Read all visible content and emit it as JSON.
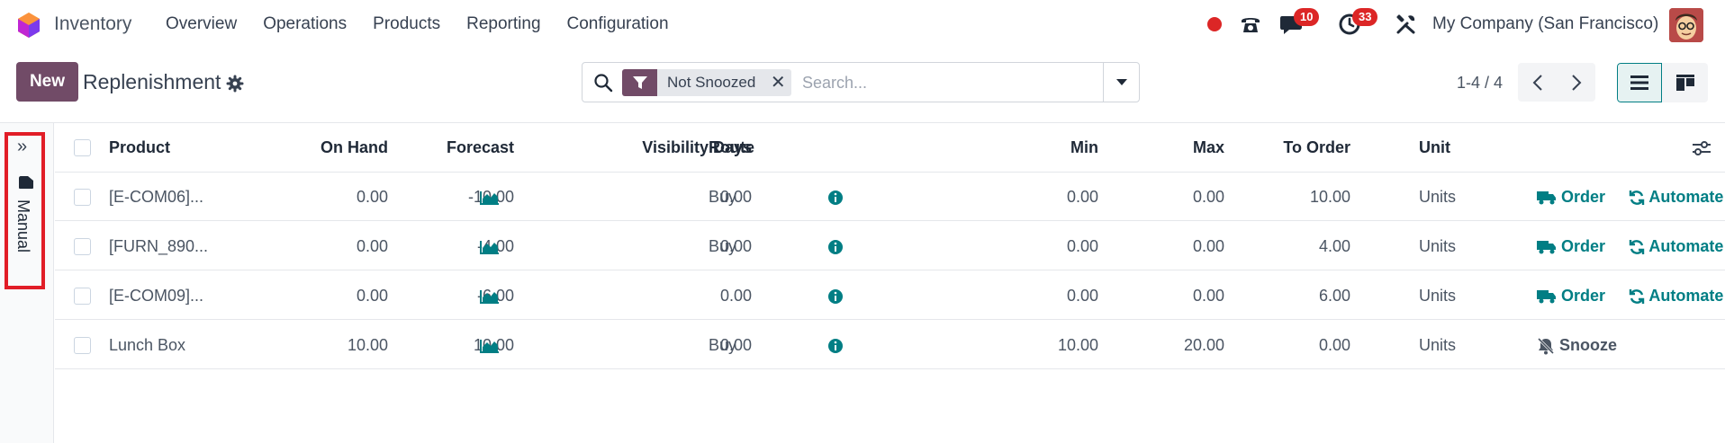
{
  "navbar": {
    "app_name": "Inventory",
    "menu": [
      "Overview",
      "Operations",
      "Products",
      "Reporting",
      "Configuration"
    ],
    "chat_badge": "10",
    "activity_badge": "33",
    "company": "My Company (San Francisco)"
  },
  "control": {
    "new_label": "New",
    "title": "Replenishment",
    "facet_label": "Not Snoozed",
    "search_placeholder": "Search...",
    "pager": "1-4 / 4"
  },
  "side_panel": {
    "label": "Manual"
  },
  "table": {
    "columns": {
      "product": "Product",
      "on_hand": "On Hand",
      "forecast": "Forecast",
      "visibility_days": "Visibility Days",
      "route": "Route",
      "min": "Min",
      "max": "Max",
      "to_order": "To Order",
      "unit": "Unit"
    },
    "rows": [
      {
        "product": "[E-COM06]...",
        "on_hand": "0.00",
        "forecast": "-10.00",
        "visibility_days": "0.00",
        "route": "Buy",
        "min": "0.00",
        "max": "0.00",
        "to_order": "10.00",
        "unit": "Units",
        "action": "Order",
        "automate": "Automate"
      },
      {
        "product": "[FURN_890...",
        "on_hand": "0.00",
        "forecast": "-4.00",
        "visibility_days": "0.00",
        "route": "Buy",
        "min": "0.00",
        "max": "0.00",
        "to_order": "4.00",
        "unit": "Units",
        "action": "Order",
        "automate": "Automate"
      },
      {
        "product": "[E-COM09]...",
        "on_hand": "0.00",
        "forecast": "-6.00",
        "visibility_days": "0.00",
        "route": "",
        "min": "0.00",
        "max": "0.00",
        "to_order": "6.00",
        "unit": "Units",
        "action": "Order",
        "automate": "Automate"
      },
      {
        "product": "Lunch Box",
        "on_hand": "10.00",
        "forecast": "10.00",
        "visibility_days": "0.00",
        "route": "Buy",
        "min": "10.00",
        "max": "20.00",
        "to_order": "0.00",
        "unit": "Units",
        "action": "Snooze"
      }
    ]
  },
  "colors": {
    "brand": "#714B67",
    "accent": "#017e84",
    "badge": "#dc2626",
    "highlight_box": "#e11d27"
  }
}
